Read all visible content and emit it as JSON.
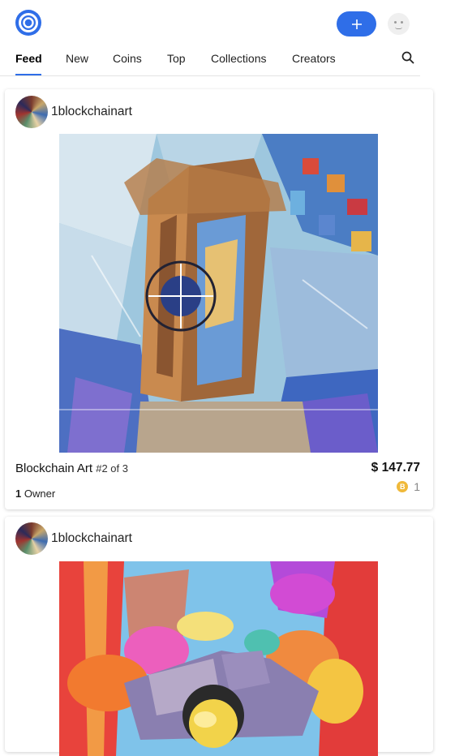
{
  "header": {
    "plus_label": "+",
    "tabs": [
      "Feed",
      "New",
      "Coins",
      "Top",
      "Collections",
      "Creators"
    ],
    "active_tab": "Feed"
  },
  "posts": [
    {
      "username": "1blockchainart",
      "title": "Blockchain Art",
      "edition": "#2 of 3",
      "price": "$ 147.77",
      "coin_symbol": "B",
      "coin_count": "1",
      "owners_count": "1",
      "owners_label": "Owner"
    },
    {
      "username": "1blockchainart"
    }
  ],
  "colors": {
    "accent": "#2f6ee8",
    "coin": "#f0b93a"
  }
}
